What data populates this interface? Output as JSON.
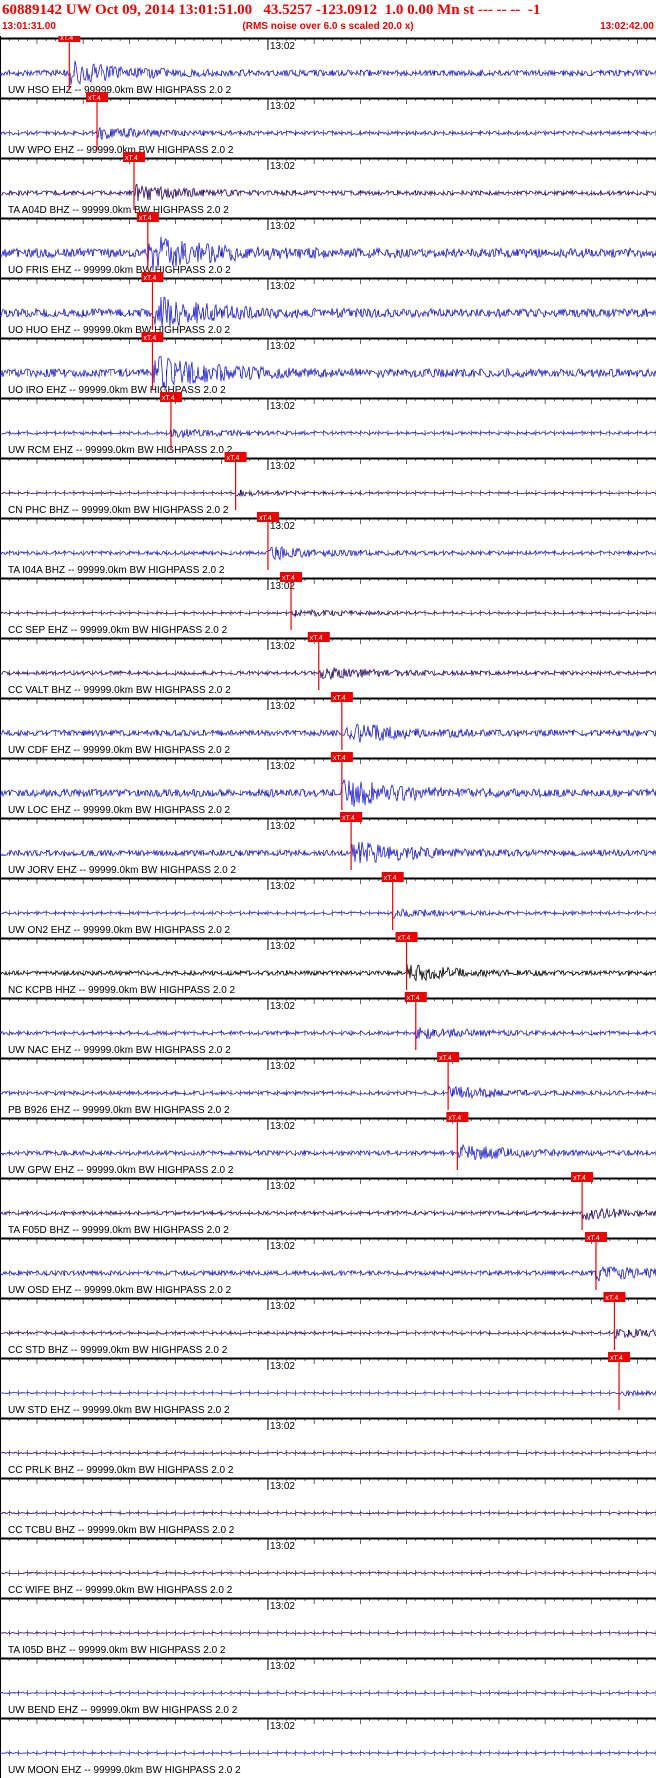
{
  "header": {
    "title": "60889142 UW Oct 09, 2014 13:01:51.00   43.5257 -123.0912  1.0 0.00 Mn st --- -- --  -1",
    "start_time": "13:01:31.00",
    "note": "(RMS noise over 6.0 s scaled 20.0 x)",
    "end_time": "13:02:42.00"
  },
  "chart_data": {
    "type": "line",
    "time_range": [
      "13:01:31.00",
      "13:02:42.00"
    ],
    "tick_label": "13:02",
    "pick_label": "xT.4",
    "colors": {
      "trace": "#1f1fd8",
      "trace_dark": "#2a0a6e",
      "trace_black": "#000000",
      "pick": "#ee0000"
    },
    "traces": [
      {
        "label": "UW HSO EHZ -- 99999.0km BW  HIGHPASS  2.0  2",
        "pick": "13:01:38.5",
        "amp": 0.35
      },
      {
        "label": "UW WPO EHZ -- 99999.0km BW  HIGHPASS  2.0  2",
        "pick": "13:01:41.5",
        "amp": 0.2
      },
      {
        "label": "TA A04D BHZ -- 99999.0km BW  HIGHPASS  2.0  2",
        "pick": "13:01:45.5",
        "amp": 0.25
      },
      {
        "label": "UO FRIS EHZ -- 99999.0km BW  HIGHPASS  2.0  2",
        "pick": "13:01:47.0",
        "amp": 0.55
      },
      {
        "label": "UO HUO EHZ -- 99999.0km BW  HIGHPASS  2.0  2",
        "pick": "13:01:47.5",
        "amp": 0.5
      },
      {
        "label": "UO IRO EHZ -- 99999.0km BW  HIGHPASS  2.0  2",
        "pick": "13:01:47.5",
        "amp": 0.5
      },
      {
        "label": "UW RCM EHZ -- 99999.0km BW  HIGHPASS  2.0  2",
        "pick": "13:01:49.5",
        "amp": 0.15
      },
      {
        "label": "CN PHC BHZ -- 99999.0km BW  HIGHPASS  2.0  2",
        "pick": "13:01:56.5",
        "amp": 0.1
      },
      {
        "label": "TA I04A BHZ -- 99999.0km BW  HIGHPASS  2.0  2",
        "pick": "13:02:00.0",
        "amp": 0.2
      },
      {
        "label": "CC SEP EHZ -- 99999.0km BW  HIGHPASS  2.0  2",
        "pick": "13:02:02.5",
        "amp": 0.12
      },
      {
        "label": "CC VALT BHZ -- 99999.0km BW  HIGHPASS  2.0  2",
        "pick": "13:02:05.5",
        "amp": 0.2
      },
      {
        "label": "UW CDF EHZ -- 99999.0km BW  HIGHPASS  2.0  2",
        "pick": "13:02:08.0",
        "amp": 0.35
      },
      {
        "label": "UW LOC EHZ -- 99999.0km BW  HIGHPASS  2.0  2",
        "pick": "13:02:08.0",
        "amp": 0.45
      },
      {
        "label": "UW JORV EHZ -- 99999.0km BW  HIGHPASS  2.0  2",
        "pick": "13:02:09.0",
        "amp": 0.35
      },
      {
        "label": "UW ON2 EHZ -- 99999.0km BW  HIGHPASS  2.0  2",
        "pick": "13:02:13.5",
        "amp": 0.15
      },
      {
        "label": "NC KCPB HHZ -- 99999.0km BW  HIGHPASS  2.0  2",
        "pick": "13:02:15.0",
        "amp": 0.25
      },
      {
        "label": "UW NAC EHZ -- 99999.0km BW  HIGHPASS  2.0  2",
        "pick": "13:02:16.0",
        "amp": 0.2
      },
      {
        "label": "PB B926 EHZ -- 99999.0km BW  HIGHPASS  2.0  2",
        "pick": "13:02:19.5",
        "amp": 0.2
      },
      {
        "label": "UW GPW EHZ -- 99999.0km BW  HIGHPASS  2.0  2",
        "pick": "13:02:20.5",
        "amp": 0.25
      },
      {
        "label": "TA F05D BHZ -- 99999.0km BW  HIGHPASS  2.0  2",
        "pick": "13:02:34.0",
        "amp": 0.2
      },
      {
        "label": "UW OSD EHZ -- 99999.0km BW  HIGHPASS  2.0  2",
        "pick": "13:02:35.5",
        "amp": 0.25
      },
      {
        "label": "CC STD BHZ -- 99999.0km BW  HIGHPASS  2.0  2",
        "pick": "13:02:37.5",
        "amp": 0.15
      },
      {
        "label": "UW STD EHZ -- 99999.0km BW  HIGHPASS  2.0  2",
        "pick": "13:02:38.0",
        "amp": 0.08
      },
      {
        "label": "CC PRLK BHZ -- 99999.0km BW  HIGHPASS  2.0  2",
        "pick": null,
        "amp": 0.1
      },
      {
        "label": "CC TCBU BHZ -- 99999.0km BW  HIGHPASS  2.0  2",
        "pick": null,
        "amp": 0.1
      },
      {
        "label": "CC WIFE BHZ -- 99999.0km BW  HIGHPASS  2.0  2",
        "pick": null,
        "amp": 0.1
      },
      {
        "label": "TA I05D BHZ -- 99999.0km BW  HIGHPASS  2.0  2",
        "pick": null,
        "amp": 0.08
      },
      {
        "label": "UW BEND EHZ -- 99999.0km BW  HIGHPASS  2.0  2",
        "pick": null,
        "amp": 0.1
      },
      {
        "label": "UW MOON EHZ -- 99999.0km BW  HIGHPASS  2.0  2",
        "pick": null,
        "amp": 0.1
      }
    ]
  }
}
